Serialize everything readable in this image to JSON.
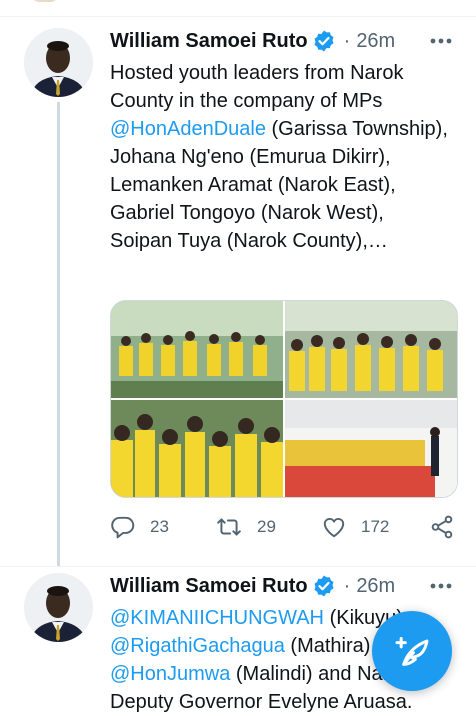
{
  "tweets": [
    {
      "author": "William Samoei Ruto",
      "time": "26m",
      "text_parts": [
        "Hosted youth leaders from Narok County in the company of MPs ",
        "@HonAdenDuale",
        " (Garissa Township), Johana Ng'eno (Emurua Dikirr), Lemanken  Aramat (Narok East), Gabriel Tongoyo (Narok West), Soipan Tuya (Narok County),…"
      ],
      "stats": {
        "replies": "23",
        "retweets": "29",
        "likes": "172"
      }
    },
    {
      "author": "William Samoei Ruto",
      "time": "26m",
      "lines": [
        {
          "mention": "@KIMANIICHUNGWAH",
          "rest": " (Kikuyu),"
        },
        {
          "mention": "@RigathiGachagua",
          "rest": " (Mathira),"
        },
        {
          "mention": "@HonJumwa",
          "rest": " (Malindi) and Nakuru"
        },
        {
          "mention": "",
          "rest": "Deputy Governor Evelyne Aruasa."
        }
      ]
    }
  ],
  "colors": {
    "accent": "#1d9bf0",
    "text": "#0f1419",
    "muted": "#536471",
    "border": "#cfd9de"
  },
  "icons": {
    "more": "more-icon",
    "verified": "verified-badge-icon",
    "reply": "reply-icon",
    "retweet": "retweet-icon",
    "like": "heart-icon",
    "share": "share-icon",
    "compose": "compose-tweet-icon"
  }
}
